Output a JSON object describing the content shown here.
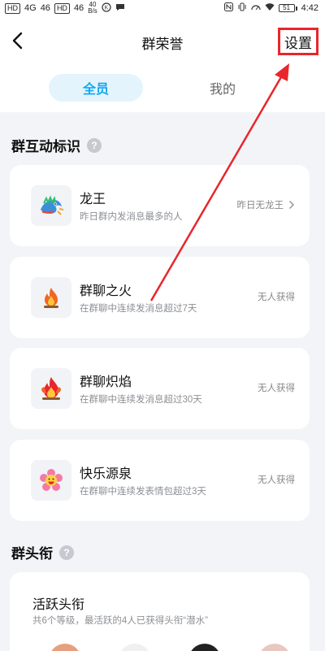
{
  "status_bar": {
    "left_items": [
      "HD",
      "4G",
      "46",
      "HD",
      "46"
    ],
    "speed_value": "40",
    "speed_unit": "B/s",
    "time": "4:42",
    "battery": "51"
  },
  "header": {
    "title": "群荣誉",
    "settings_label": "设置"
  },
  "tabs": {
    "all_label": "全员",
    "mine_label": "我的"
  },
  "section_interaction": {
    "title": "群互动标识"
  },
  "badges": [
    {
      "name": "龙王",
      "desc": "昨日群内发消息最多的人",
      "status": "昨日无龙王",
      "icon": "dragon-king-icon",
      "has_chevron": true
    },
    {
      "name": "群聊之火",
      "desc": "在群聊中连续发消息超过7天",
      "status": "无人获得",
      "icon": "fire-icon",
      "has_chevron": false
    },
    {
      "name": "群聊炽焰",
      "desc": "在群聊中连续发消息超过30天",
      "status": "无人获得",
      "icon": "blazing-fire-icon",
      "has_chevron": false
    },
    {
      "name": "快乐源泉",
      "desc": "在群聊中连续发表情包超过3天",
      "status": "无人获得",
      "icon": "happy-flower-icon",
      "has_chevron": false
    }
  ],
  "section_title_tag": {
    "title": "群头衔"
  },
  "active_title": {
    "name": "活跃头衔",
    "desc": "共6个等级，最活跃的4人已获得头衔“潜水”"
  },
  "colors": {
    "accent": "#11a6f2",
    "annotation": "#e8262b"
  }
}
